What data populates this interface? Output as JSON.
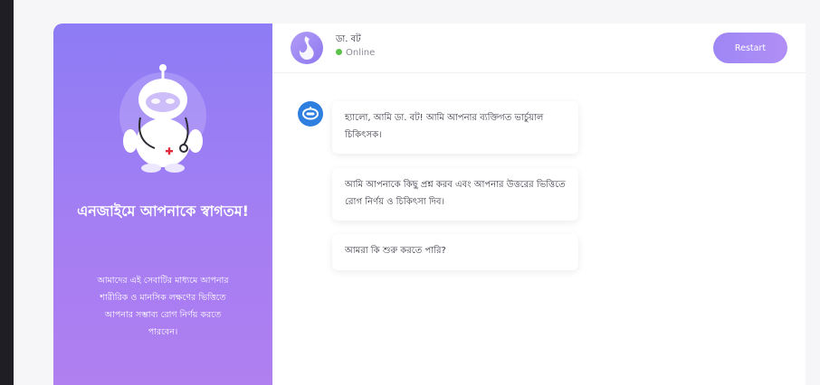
{
  "welcome": {
    "title": "এনজাইমে আপনাকে স্বাগতম!",
    "description": "আমাদের এই সেবাটির মাধ্যমে আপনার শারীরিক ও মানসিক লক্ষণের ভিত্তিতে আপনার সম্ভাব্য রোগ নির্ণয় করতে পারবেন।"
  },
  "header": {
    "bot_name": "ডা. বট",
    "status": "Online",
    "restart_label": "Restart"
  },
  "messages": [
    {
      "sender": "bot",
      "text": "হ্যালো, আমি ডা. বট! আমি আপনার ব্যক্তিগত ভার্চুয়াল চিকিৎসক।"
    },
    {
      "sender": "bot",
      "text": "আমি আপনাকে কিছু প্রশ্ন করব এবং আপনার উত্তরের ভিত্তিতে রোগ নির্ণয় ও চিকিৎসা দিব।"
    },
    {
      "sender": "bot",
      "text": "আমরা কি শুরু করতে পারি?"
    }
  ],
  "colors": {
    "accent": "#9d86f5",
    "online": "#5cc24a",
    "bot_badge": "#2f7fe0"
  },
  "icons": {
    "robot": "robot-doctor-illustration",
    "avatar": "bot-logo-icon",
    "badge": "chat-bot-icon"
  }
}
